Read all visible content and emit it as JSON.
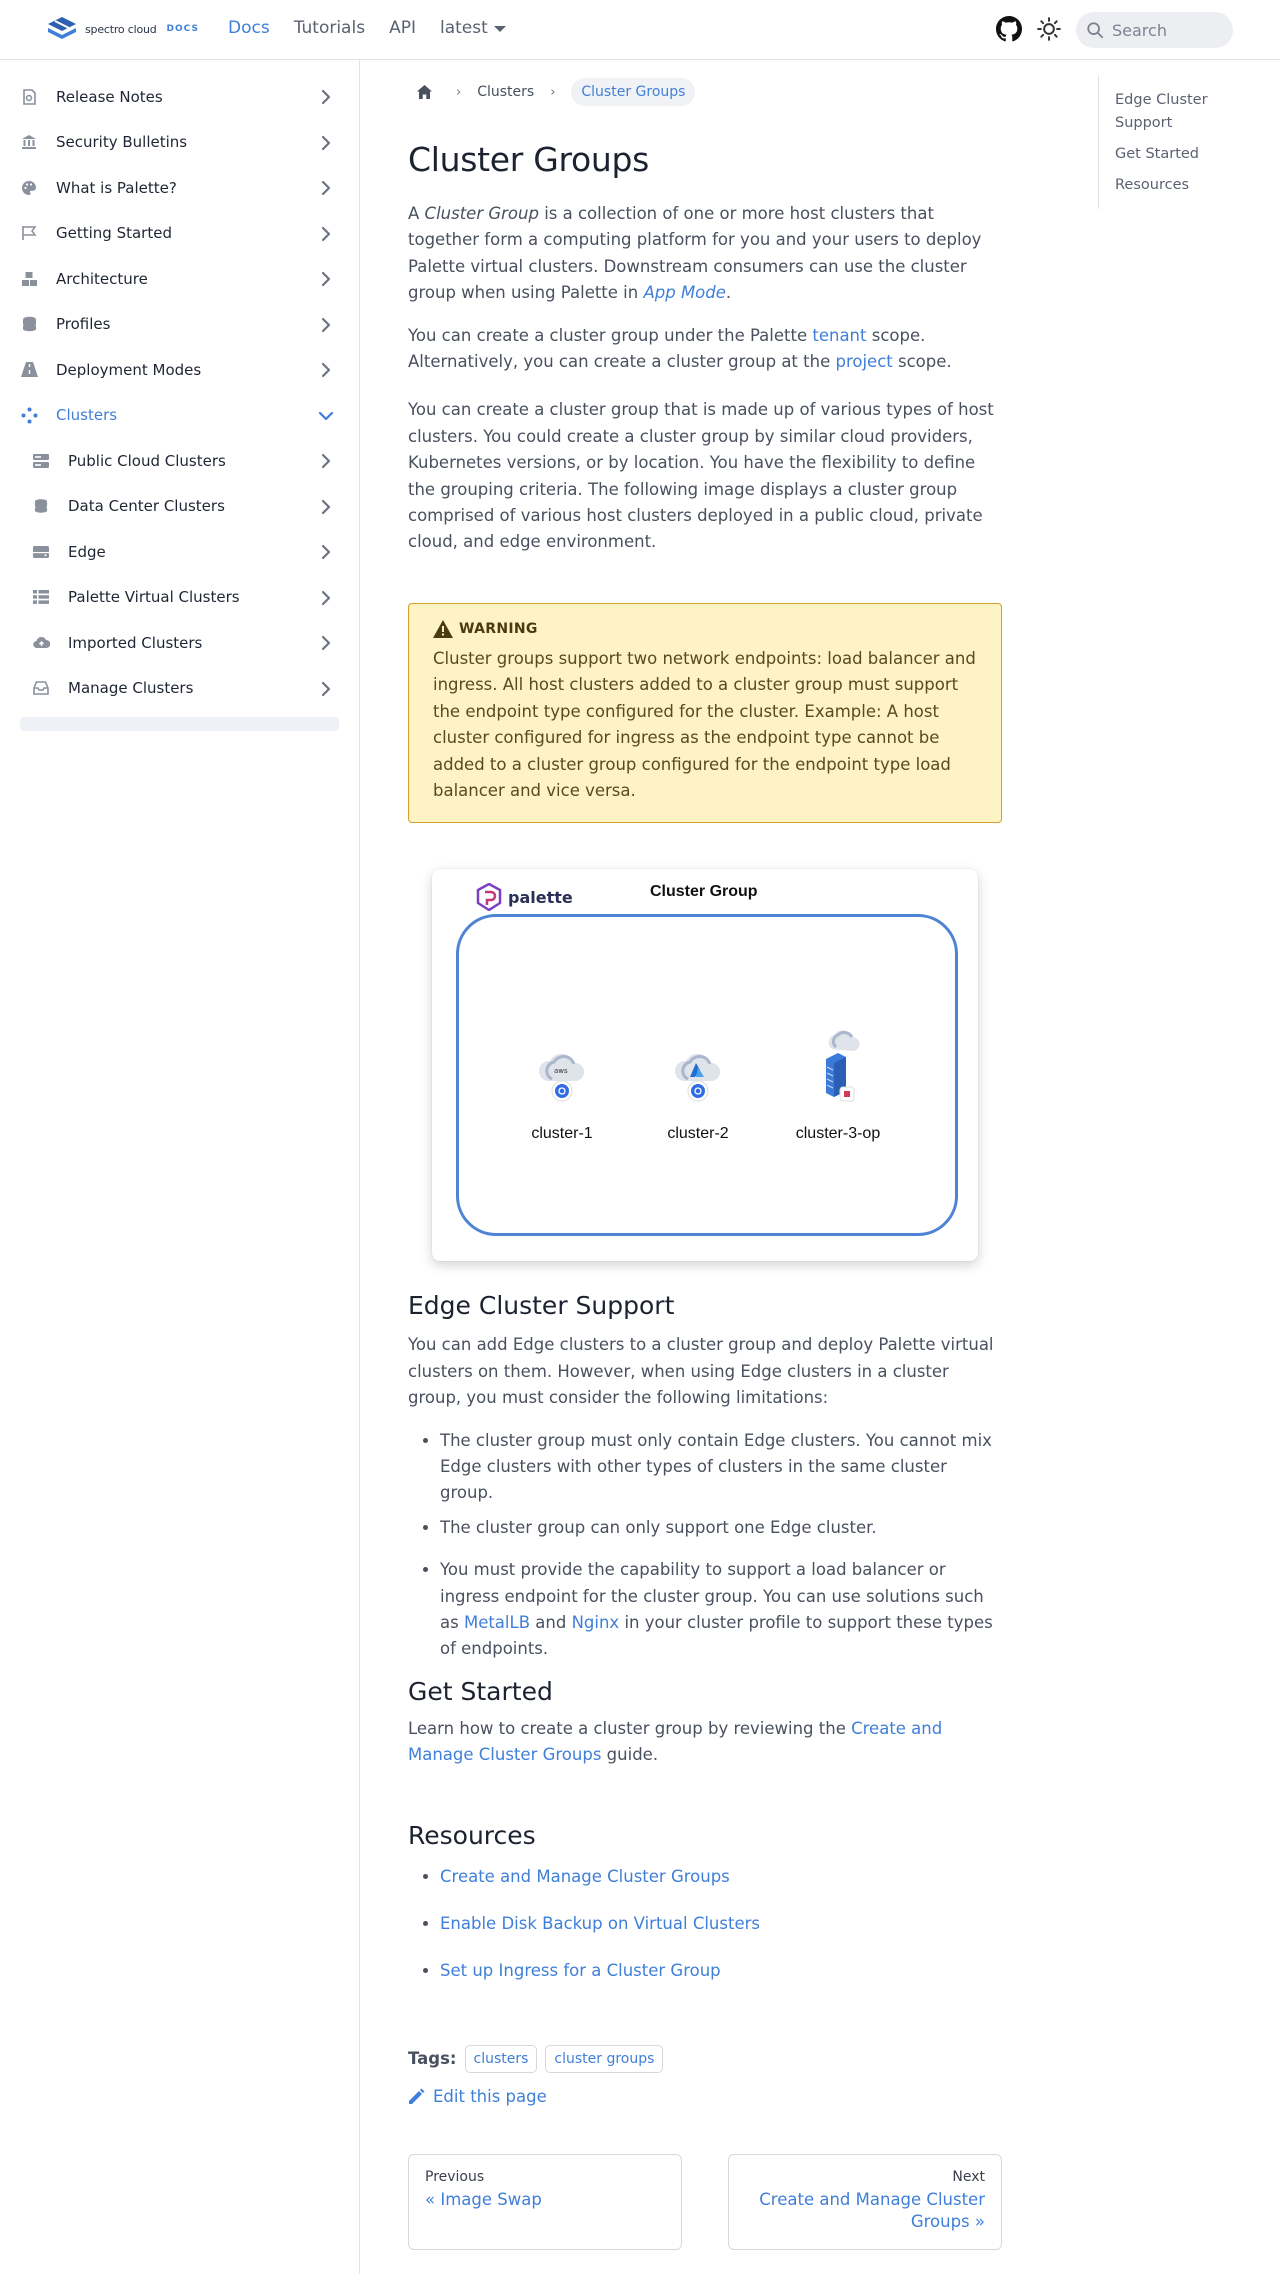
{
  "header": {
    "logo_text": "spectro cloud",
    "logo_docs": "DOCS",
    "nav": [
      "Docs",
      "Tutorials",
      "API"
    ],
    "version": "latest",
    "search_placeholder": "Search"
  },
  "sidebar": {
    "items": [
      {
        "label": "Release Notes",
        "icon": "release-notes-icon"
      },
      {
        "label": "Security Bulletins",
        "icon": "bank-icon"
      },
      {
        "label": "What is Palette?",
        "icon": "palette-icon"
      },
      {
        "label": "Getting Started",
        "icon": "flag-icon"
      },
      {
        "label": "Architecture",
        "icon": "cubes-icon"
      },
      {
        "label": "Profiles",
        "icon": "database-icon"
      },
      {
        "label": "Deployment Modes",
        "icon": "road-icon"
      },
      {
        "label": "Clusters",
        "icon": "cluster-nodes-icon"
      }
    ],
    "sub_items": [
      {
        "label": "Public Cloud Clusters",
        "icon": "server-icon"
      },
      {
        "label": "Data Center Clusters",
        "icon": "database-icon"
      },
      {
        "label": "Edge",
        "icon": "hdd-icon"
      },
      {
        "label": "Palette Virtual Clusters",
        "icon": "table-list-icon"
      },
      {
        "label": "Imported Clusters",
        "icon": "cloud-upload-icon"
      },
      {
        "label": "Manage Clusters",
        "icon": "inbox-icon"
      }
    ]
  },
  "breadcrumb": {
    "items": [
      "Clusters",
      "Cluster Groups"
    ]
  },
  "page": {
    "title": "Cluster Groups",
    "intro": {
      "a": "A ",
      "cg": "Cluster Group",
      "b": " is a collection of one or more host clusters that together form a computing platform for you and your users to deploy Palette virtual clusters. Downstream consumers can use the cluster group when using Palette in ",
      "app_mode": "App Mode",
      "c": "."
    },
    "scope": {
      "a": "You can create a cluster group under the Palette ",
      "tenant": "tenant",
      "b": " scope. Alternatively, you can create a cluster group at the ",
      "project": "project",
      "c": " scope."
    },
    "types_text": "You can create a cluster group that is made up of various types of host clusters. You could create a cluster group by similar cloud providers, Kubernetes versions, or by location. You have the flexibility to define the grouping criteria. The following image displays a cluster group comprised of various host clusters deployed in a public cloud, private cloud, and edge environment.",
    "warning": {
      "label": "WARNING",
      "text": "Cluster groups support two network endpoints: load balancer and ingress. All host clusters added to a cluster group must support the endpoint type configured for the cluster. Example: A host cluster configured for ingress as the endpoint type cannot be added to a cluster group configured for the endpoint type load balancer and vice versa."
    },
    "figure": {
      "brand": "palette",
      "title": "Cluster Group",
      "clusters": [
        "cluster-1",
        "cluster-2",
        "cluster-3-op"
      ]
    },
    "edge": {
      "heading": "Edge Cluster Support",
      "text": "You can add Edge clusters to a cluster group and deploy Palette virtual clusters on them. However, when using Edge clusters in a cluster group, you must consider the following limitations:",
      "b1": "The cluster group must only contain Edge clusters. You cannot mix Edge clusters with other types of clusters in the same cluster group.",
      "b2": "The cluster group can only support one Edge cluster.",
      "b3a": "You must provide the capability to support a load balancer or ingress endpoint for the cluster group. You can use solutions such as ",
      "metallb": "MetalLB",
      "b3b": " and ",
      "nginx": "Nginx",
      "b3c": " in your cluster profile to support these types of endpoints."
    },
    "start": {
      "heading": "Get Started",
      "a": "Learn how to create a cluster group by reviewing the ",
      "link": "Create and Manage Cluster Groups",
      "b": " guide."
    },
    "resources": {
      "heading": "Resources",
      "links": [
        "Create and Manage Cluster Groups",
        "Enable Disk Backup on Virtual Clusters",
        "Set up Ingress for a Cluster Group"
      ]
    },
    "tags": {
      "label": "Tags:",
      "items": [
        "clusters",
        "cluster groups"
      ]
    },
    "edit": "Edit this page",
    "pager": {
      "prev_label": "Previous",
      "prev_title": "« Image Swap",
      "next_label": "Next",
      "next_title": "Create and Manage Cluster Groups »"
    }
  },
  "toc": {
    "items": [
      "Edge Cluster Support",
      "Get Started",
      "Resources"
    ]
  },
  "colors": {
    "accent": "#3f7fd9",
    "warning_bg": "#fdf3c4",
    "warning_border": "#d2a02a"
  }
}
